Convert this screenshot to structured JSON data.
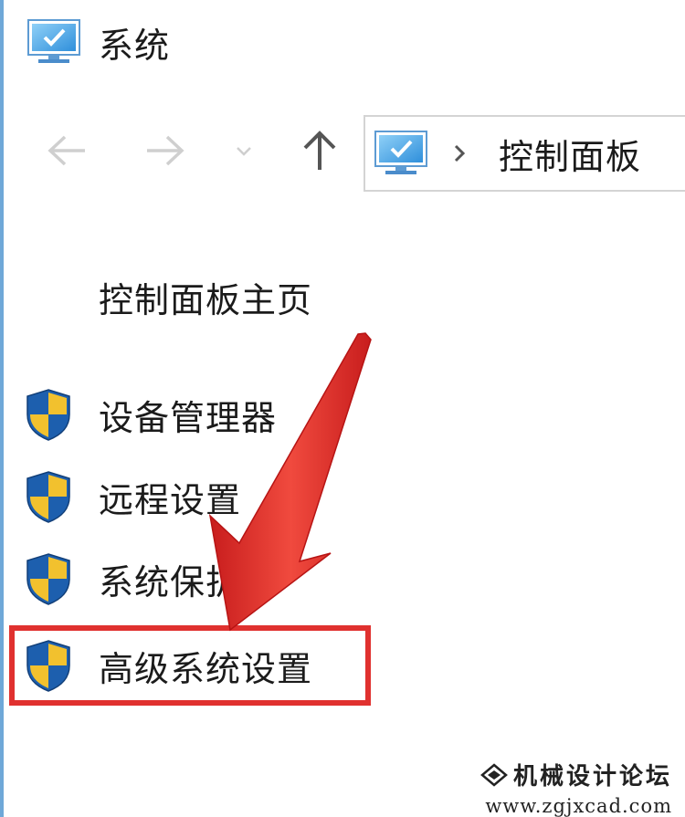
{
  "window": {
    "title": "系统",
    "icon": "monitor-icon"
  },
  "nav": {
    "back_icon": "arrow-left-icon",
    "forward_icon": "arrow-right-icon",
    "recent_icon": "chevron-down-icon",
    "up_icon": "arrow-up-icon",
    "address": {
      "icon": "monitor-icon",
      "separator_icon": "chevron-right-icon",
      "path": [
        "控制面板"
      ]
    }
  },
  "sidebar": {
    "home_link": "控制面板主页",
    "items": [
      {
        "label": "设备管理器",
        "icon": "uac-shield-icon"
      },
      {
        "label": "远程设置",
        "icon": "uac-shield-icon"
      },
      {
        "label": "系统保护",
        "icon": "uac-shield-icon"
      },
      {
        "label": "高级系统设置",
        "icon": "uac-shield-icon",
        "highlighted": true
      }
    ]
  },
  "annotation": {
    "arrow_color": "#e0312f",
    "box_color": "#e0312f"
  },
  "watermark": {
    "name": "机械设计论坛",
    "url": "www.zgjxcad.com"
  },
  "colors": {
    "accent": "#3f8fd6",
    "shield_blue": "#1d5fae",
    "shield_yellow": "#f2c12e"
  }
}
